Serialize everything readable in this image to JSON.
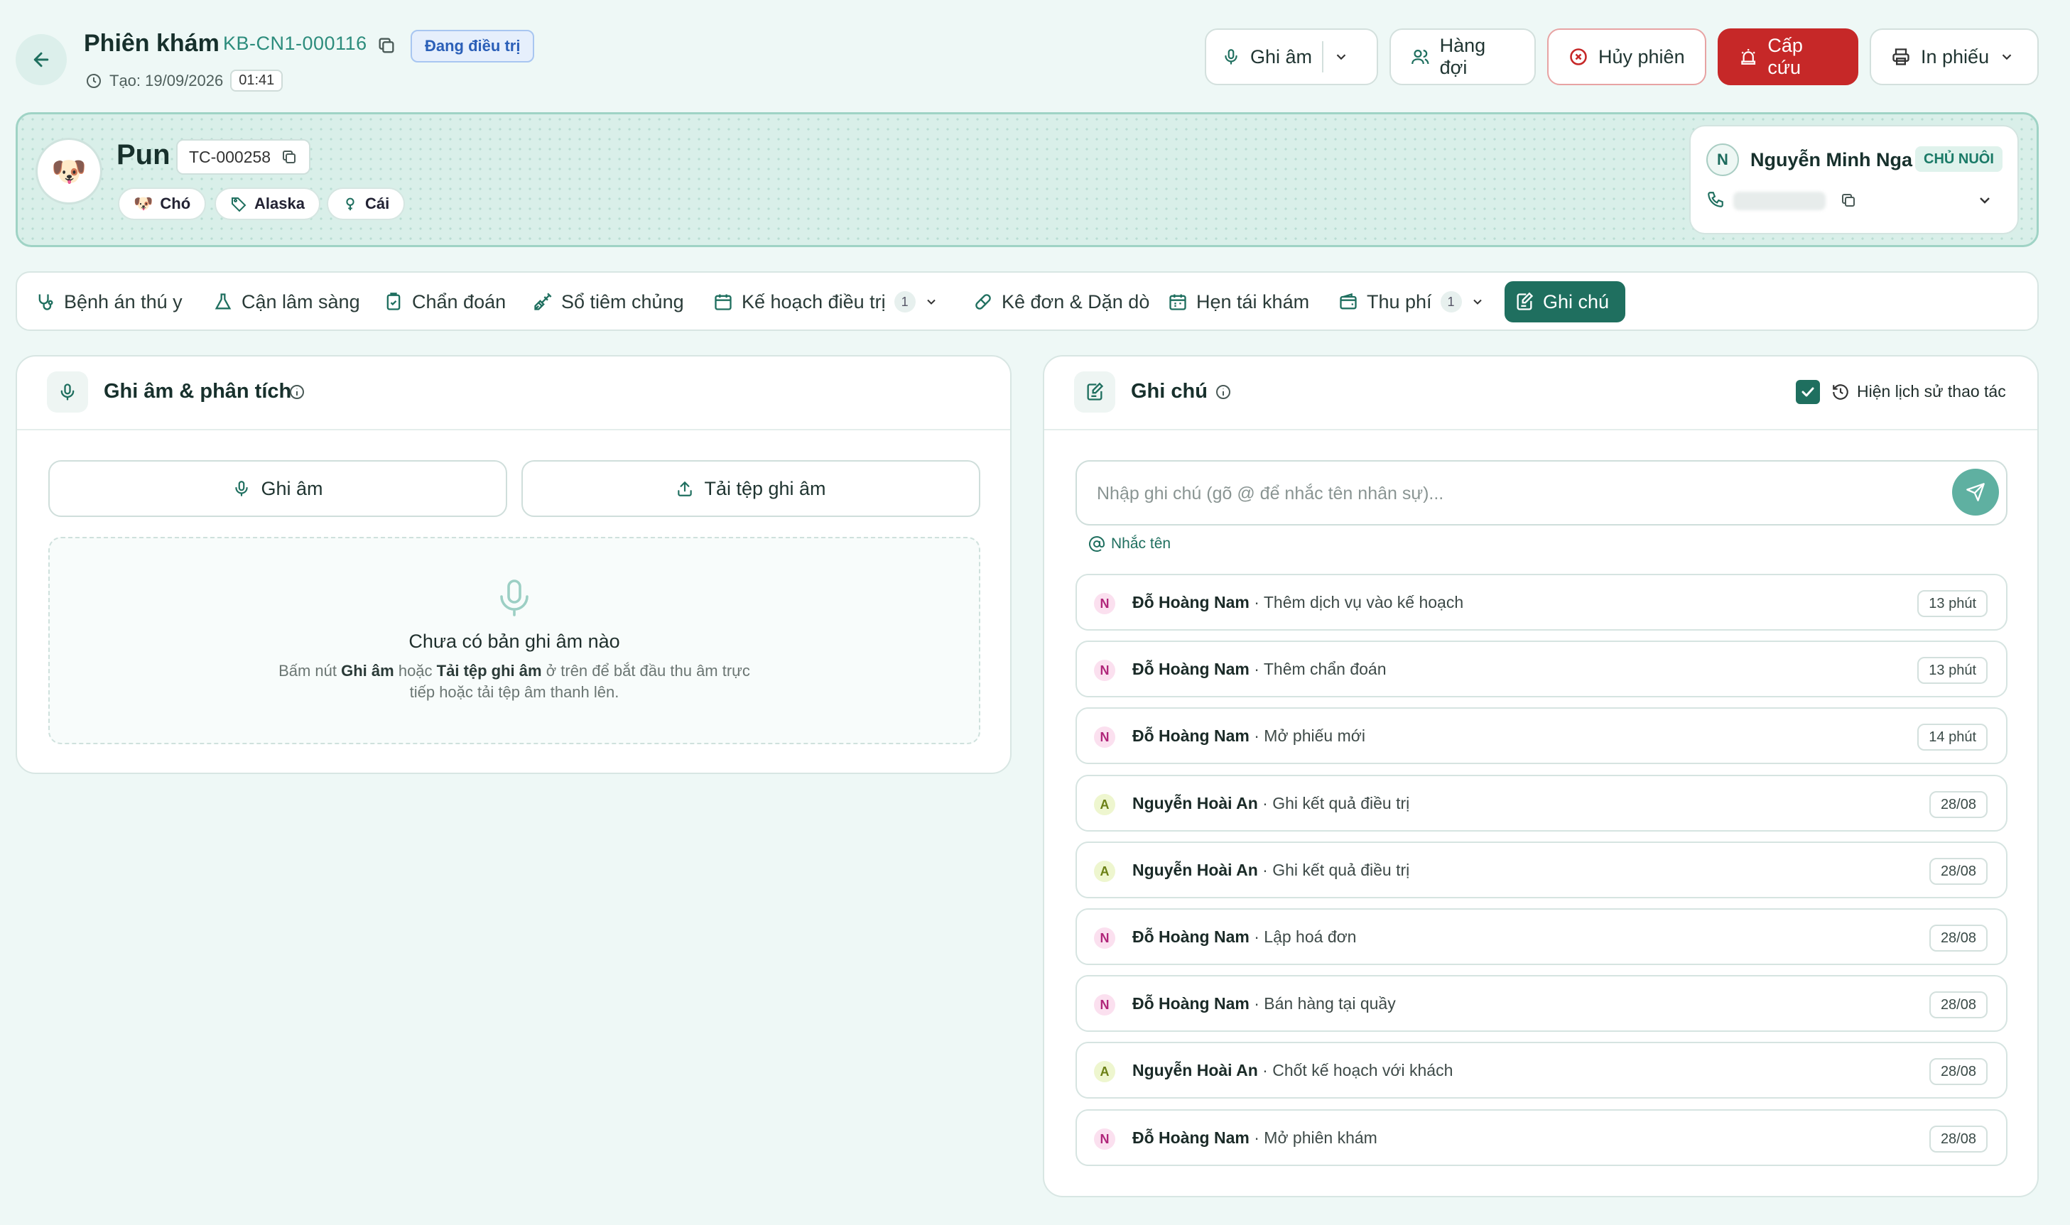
{
  "header": {
    "title": "Phiên khám",
    "session_code": "KB-CN1-000116",
    "status": "Đang điều trị",
    "created_label": "Tạo: 19/09/2026",
    "created_time": "01:41",
    "buttons": {
      "record": "Ghi âm",
      "queue": "Hàng đợi",
      "cancel": "Hủy phiên",
      "emergency": "Cấp cứu",
      "print": "In phiếu"
    }
  },
  "patient": {
    "avatar": "🐶",
    "name": "Pun",
    "code": "TC-000258",
    "tags": [
      {
        "icon": "🐶",
        "label": "Chó"
      },
      {
        "icon": "tag-icon",
        "label": "Alaska"
      },
      {
        "icon": "female-icon",
        "label": "Cái"
      }
    ]
  },
  "owner": {
    "initial": "N",
    "name": "Nguyễn Minh Nga",
    "role": "CHỦ NUÔI"
  },
  "tabs": [
    {
      "label": "Bệnh án thú y",
      "icon": "stethoscope-icon"
    },
    {
      "label": "Cận lâm sàng",
      "icon": "flask-icon"
    },
    {
      "label": "Chẩn đoán",
      "icon": "clipboard-icon"
    },
    {
      "label": "Sổ tiêm chủng",
      "icon": "syringe-icon"
    },
    {
      "label": "Kế hoạch điều trị",
      "icon": "calendar-icon",
      "count": "1"
    },
    {
      "label": "Kê đơn & Dặn dò",
      "icon": "pill-icon"
    },
    {
      "label": "Hẹn tái khám",
      "icon": "calendar-icon"
    },
    {
      "label": "Thu phí",
      "icon": "wallet-icon",
      "count": "1"
    },
    {
      "label": "Ghi chú",
      "icon": "note-icon",
      "active": true
    }
  ],
  "recording": {
    "title": "Ghi âm & phân tích",
    "record_button": "Ghi âm",
    "upload_button": "Tải tệp ghi âm",
    "empty_title": "Chưa có bản ghi âm nào",
    "empty_desc_1": "Bấm nút",
    "empty_desc_b1": "Ghi âm",
    "empty_desc_2": "hoặc",
    "empty_desc_b2": "Tải tệp ghi âm",
    "empty_desc_3": "ở trên để bắt đầu thu âm trực",
    "empty_desc_4": "tiếp hoặc tải tệp âm thanh lên."
  },
  "notes": {
    "title": "Ghi chú",
    "show_history_label": "Hiện lịch sử thao tác",
    "show_history_checked": true,
    "input_placeholder": "Nhập ghi chú (gõ @ để nhắc tên nhân sự)...",
    "mention_label": "Nhắc tên",
    "log": [
      {
        "initial": "N",
        "who": "Đỗ Hoàng Nam",
        "action": "· Thêm dịch vụ vào kế hoạch",
        "time": "13 phút"
      },
      {
        "initial": "N",
        "who": "Đỗ Hoàng Nam",
        "action": "· Thêm chẩn đoán",
        "time": "13 phút"
      },
      {
        "initial": "N",
        "who": "Đỗ Hoàng Nam",
        "action": "· Mở phiếu mới",
        "time": "14 phút"
      },
      {
        "initial": "A",
        "who": "Nguyễn Hoài An",
        "action": "· Ghi kết quả điều trị",
        "time": "28/08"
      },
      {
        "initial": "A",
        "who": "Nguyễn Hoài An",
        "action": "· Ghi kết quả điều trị",
        "time": "28/08"
      },
      {
        "initial": "N",
        "who": "Đỗ Hoàng Nam",
        "action": "· Lập hoá đơn",
        "time": "28/08"
      },
      {
        "initial": "N",
        "who": "Đỗ Hoàng Nam",
        "action": "· Bán hàng tại quầy",
        "time": "28/08"
      },
      {
        "initial": "A",
        "who": "Nguyễn Hoài An",
        "action": "· Chốt kế hoạch với khách",
        "time": "28/08"
      },
      {
        "initial": "N",
        "who": "Đỗ Hoàng Nam",
        "action": "· Mở phiên khám",
        "time": "28/08"
      }
    ]
  },
  "colors": {
    "accent": "#1f6f5f",
    "emergency": "#c62828",
    "status_blue": "#2b5fb8"
  }
}
